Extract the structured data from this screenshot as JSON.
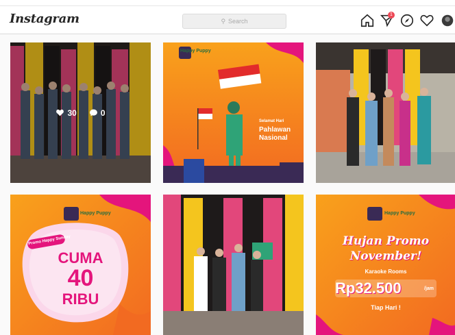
{
  "header": {
    "logo": "Instagram",
    "search_placeholder": "Search",
    "notification_count": "1"
  },
  "posts": [
    {
      "kind": "photo",
      "likes": "30",
      "comments": "0"
    },
    {
      "kind": "promo",
      "brand": "Happy Puppy",
      "small": "Selamat Hari",
      "title1": "Pahlawan",
      "title2": "Nasional"
    },
    {
      "kind": "photo"
    },
    {
      "kind": "promo",
      "tag": "Promo Happy Sunday",
      "line1": "CUMA",
      "line2": "40",
      "line3": "RIBU",
      "brand": "Happy Puppy"
    },
    {
      "kind": "photo"
    },
    {
      "kind": "promo",
      "brand": "Happy Puppy",
      "script1": "Hujan Promo",
      "script2": "November!",
      "sub": "Karaoke Rooms",
      "price": "Rp32.500",
      "unit": "/jam",
      "footer": "Tiap Hari !"
    }
  ],
  "colors": {
    "orange": "#f7941d",
    "magenta": "#e4157c",
    "yellow": "#f4c51e",
    "wall_pink": "#e2477b"
  }
}
